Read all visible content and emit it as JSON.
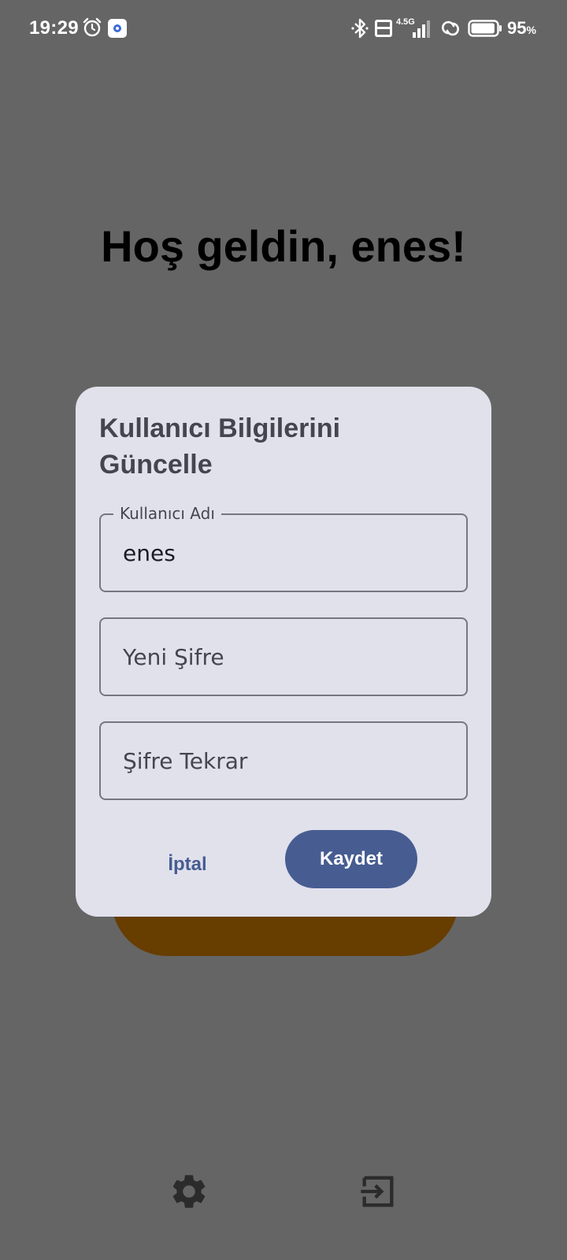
{
  "status_bar": {
    "time": "19:29",
    "network_type": "4.5G",
    "battery_percent": "95",
    "battery_unit": "%",
    "battery_level": 0.95,
    "icons": [
      "alarm-icon",
      "app-notification-icon",
      "bluetooth-icon",
      "volte-icon",
      "signal-icon",
      "hotspot-icon",
      "battery-icon"
    ]
  },
  "greeting": "Hoş geldin, enes!",
  "dialog": {
    "title": "Kullanıcı Bilgilerini Güncelle",
    "username_label": "Kullanıcı Adı",
    "username_value": "enes",
    "new_password_placeholder": "Yeni Şifre",
    "confirm_password_placeholder": "Şifre Tekrar",
    "cancel_label": "İptal",
    "save_label": "Kaydet"
  },
  "bottom_bar": {
    "icons": [
      "settings-icon",
      "logout-icon"
    ]
  },
  "colors": {
    "scrim_background": "#656565",
    "dialog_surface": "#e1e1ec",
    "primary": "#475d92",
    "background_button": "#673d00",
    "on_surface_variant": "#44464f"
  }
}
